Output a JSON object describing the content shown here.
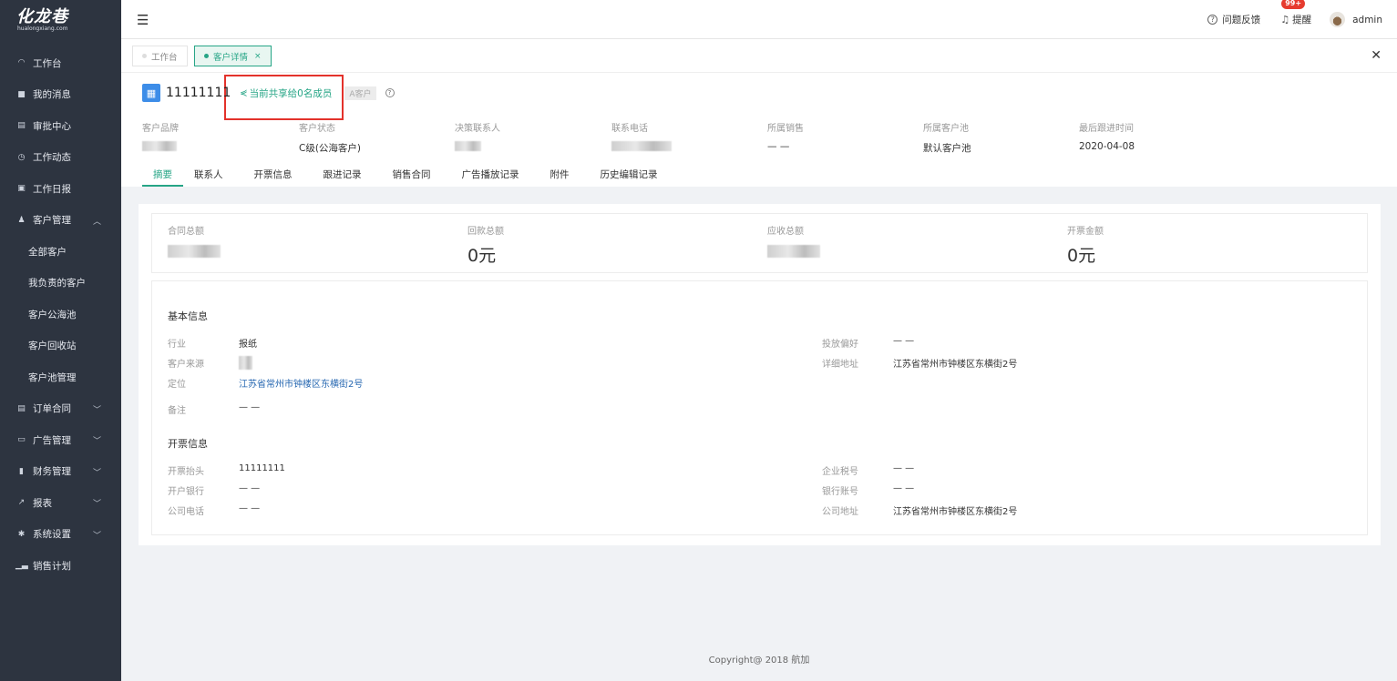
{
  "app": {
    "logo_text": "化龙巷",
    "logo_sub": "hualongxiang.com"
  },
  "sidebar": {
    "items": [
      {
        "label": "工作台",
        "icon": "dashboard-icon"
      },
      {
        "label": "我的消息",
        "icon": "message-icon"
      },
      {
        "label": "审批中心",
        "icon": "approval-icon"
      },
      {
        "label": "工作动态",
        "icon": "clock-icon"
      },
      {
        "label": "工作日报",
        "icon": "calendar-icon"
      },
      {
        "label": "客户管理",
        "icon": "user-group-icon",
        "expanded": true,
        "children": [
          "全部客户",
          "我负责的客户",
          "客户公海池",
          "客户回收站",
          "客户池管理"
        ]
      },
      {
        "label": "订单合同",
        "icon": "document-icon"
      },
      {
        "label": "广告管理",
        "icon": "monitor-icon"
      },
      {
        "label": "财务管理",
        "icon": "wallet-icon"
      },
      {
        "label": "报表",
        "icon": "trend-chart-icon"
      },
      {
        "label": "系统设置",
        "icon": "gear-icon"
      },
      {
        "label": "销售计划",
        "icon": "bar-chart-icon"
      }
    ]
  },
  "topbar": {
    "feedback": "问题反馈",
    "remind": "提醒",
    "badge": "99+",
    "user": "admin"
  },
  "tabs": [
    {
      "label": "工作台",
      "active": false
    },
    {
      "label": "客户详情",
      "active": true,
      "close": "×"
    }
  ],
  "tabs_close_all": "✕",
  "customer": {
    "name": "11111111",
    "share_text": "当前共享给0名成员",
    "tag": "A客户",
    "fields": [
      {
        "label": "客户品牌",
        "value": ""
      },
      {
        "label": "客户状态",
        "value": "C级(公海客户)"
      },
      {
        "label": "决策联系人",
        "value": ""
      },
      {
        "label": "联系电话",
        "value": ""
      },
      {
        "label": "所属销售",
        "value": "— —"
      },
      {
        "label": "所属客户池",
        "value": "默认客户池"
      },
      {
        "label": "最后跟进时间",
        "value": "2020-04-08"
      }
    ],
    "sub_tabs": [
      "摘要",
      "联系人",
      "开票信息",
      "跟进记录",
      "销售合同",
      "广告播放记录",
      "附件",
      "历史编辑记录"
    ]
  },
  "stats": [
    {
      "label": "合同总额",
      "value": ""
    },
    {
      "label": "回款总额",
      "value": "0元"
    },
    {
      "label": "应收总额",
      "value": ""
    },
    {
      "label": "开票金额",
      "value": "0元"
    }
  ],
  "basic_info": {
    "title": "基本信息",
    "industry_label": "行业",
    "industry_value": "报纸",
    "source_label": "客户来源",
    "source_value": "",
    "location_label": "定位",
    "location_value": "江苏省常州市钟楼区东横街2号",
    "remark_label": "备注",
    "remark_value": "— —",
    "pref_label": "投放偏好",
    "pref_value": "— —",
    "address_label": "详细地址",
    "address_value": "江苏省常州市钟楼区东横街2号"
  },
  "invoice_info": {
    "title": "开票信息",
    "head_label": "开票抬头",
    "head_value": "11111111",
    "bank_label": "开户银行",
    "bank_value": "— —",
    "phone_label": "公司电话",
    "phone_value": "— —",
    "tax_label": "企业税号",
    "tax_value": "— —",
    "account_label": "银行账号",
    "account_value": "— —",
    "company_addr_label": "公司地址",
    "company_addr_value": "江苏省常州市钟楼区东横街2号"
  },
  "footer": "Copyright@ 2018 航加",
  "colors": {
    "sidebar_bg": "#2d3440",
    "accent": "#26a586",
    "link": "#2466b0",
    "highlight": "#e3322b",
    "badge": "#e63b2e"
  }
}
